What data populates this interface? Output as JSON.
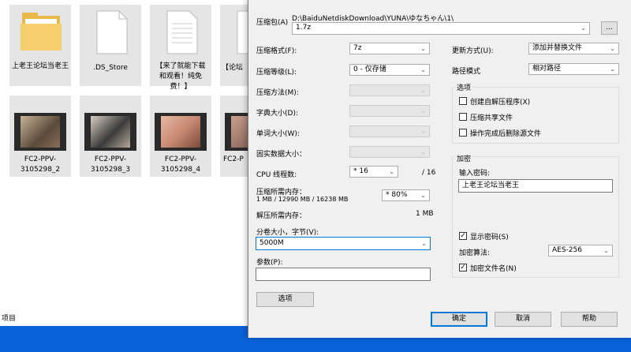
{
  "explorer": {
    "tiles_row1": [
      {
        "label": "上老王论坛当老王",
        "kind": "folder"
      },
      {
        "label": ".DS_Store",
        "kind": "file"
      },
      {
        "label": "【来了就能下载和观看！纯免费！】",
        "kind": "file"
      },
      {
        "label": "【论坛",
        "kind": "file"
      }
    ],
    "tiles_row2": [
      {
        "label": "FC2-PPV-3105298_2",
        "kind": "video"
      },
      {
        "label": "FC2-PPV-3105298_3",
        "kind": "video"
      },
      {
        "label": "FC2-PPV-3105298_4",
        "kind": "video"
      },
      {
        "label": "FC2-P",
        "kind": "video"
      }
    ],
    "status": "项目",
    "taskbar_color": "#0a62d8"
  },
  "dialog": {
    "archive_label": "压缩包(A)",
    "archive_path": "D:\\BaiduNetdiskDownload\\YUNA\\ゆなちゃん\\1\\",
    "archive_name": "1.7z",
    "browse_label": "...",
    "left": {
      "format_label": "压缩格式(F):",
      "format_value": "7z",
      "level_label": "压缩等级(L):",
      "level_value": "0 - 仅存储",
      "method_label": "压缩方法(M):",
      "dict_label": "字典大小(D):",
      "word_label": "单词大小(W):",
      "solid_label": "固实数据大小：",
      "threads_label": "CPU 线程数:",
      "threads_value": "* 16",
      "threads_total": "/ 16",
      "mem_label": "压缩所需内存：",
      "mem_detail": "1 MB / 12990 MB / 16238 MB",
      "mem_percent": "* 80%",
      "demem_label": "解压所需内存：",
      "demem_value": "1 MB",
      "split_label": "分卷大小，字节(V):",
      "split_value": "5000M",
      "params_label": "参数(P):",
      "params_value": "",
      "options_button": "选项"
    },
    "right": {
      "update_label": "更新方式(U):",
      "update_value": "添加并替换文件",
      "path_label": "路径模式",
      "path_value": "相对路径",
      "options_group": "选项",
      "opt_sfx": {
        "label": "创建自解压程序(X)",
        "checked": false
      },
      "opt_shared": {
        "label": "压缩共享文件",
        "checked": false
      },
      "opt_delete": {
        "label": "操作完成后删除源文件",
        "checked": false
      },
      "enc_group": "加密",
      "pwd_label": "输入密码:",
      "pwd_value": "上老王论坛当老王",
      "show_pwd": {
        "label": "显示密码(S)",
        "checked": true
      },
      "enc_method_label": "加密算法:",
      "enc_method_value": "AES-256",
      "enc_names": {
        "label": "加密文件名(N)",
        "checked": true
      }
    },
    "buttons": {
      "ok": "确定",
      "cancel": "取消",
      "help": "帮助"
    },
    "checkmark": "✓"
  }
}
